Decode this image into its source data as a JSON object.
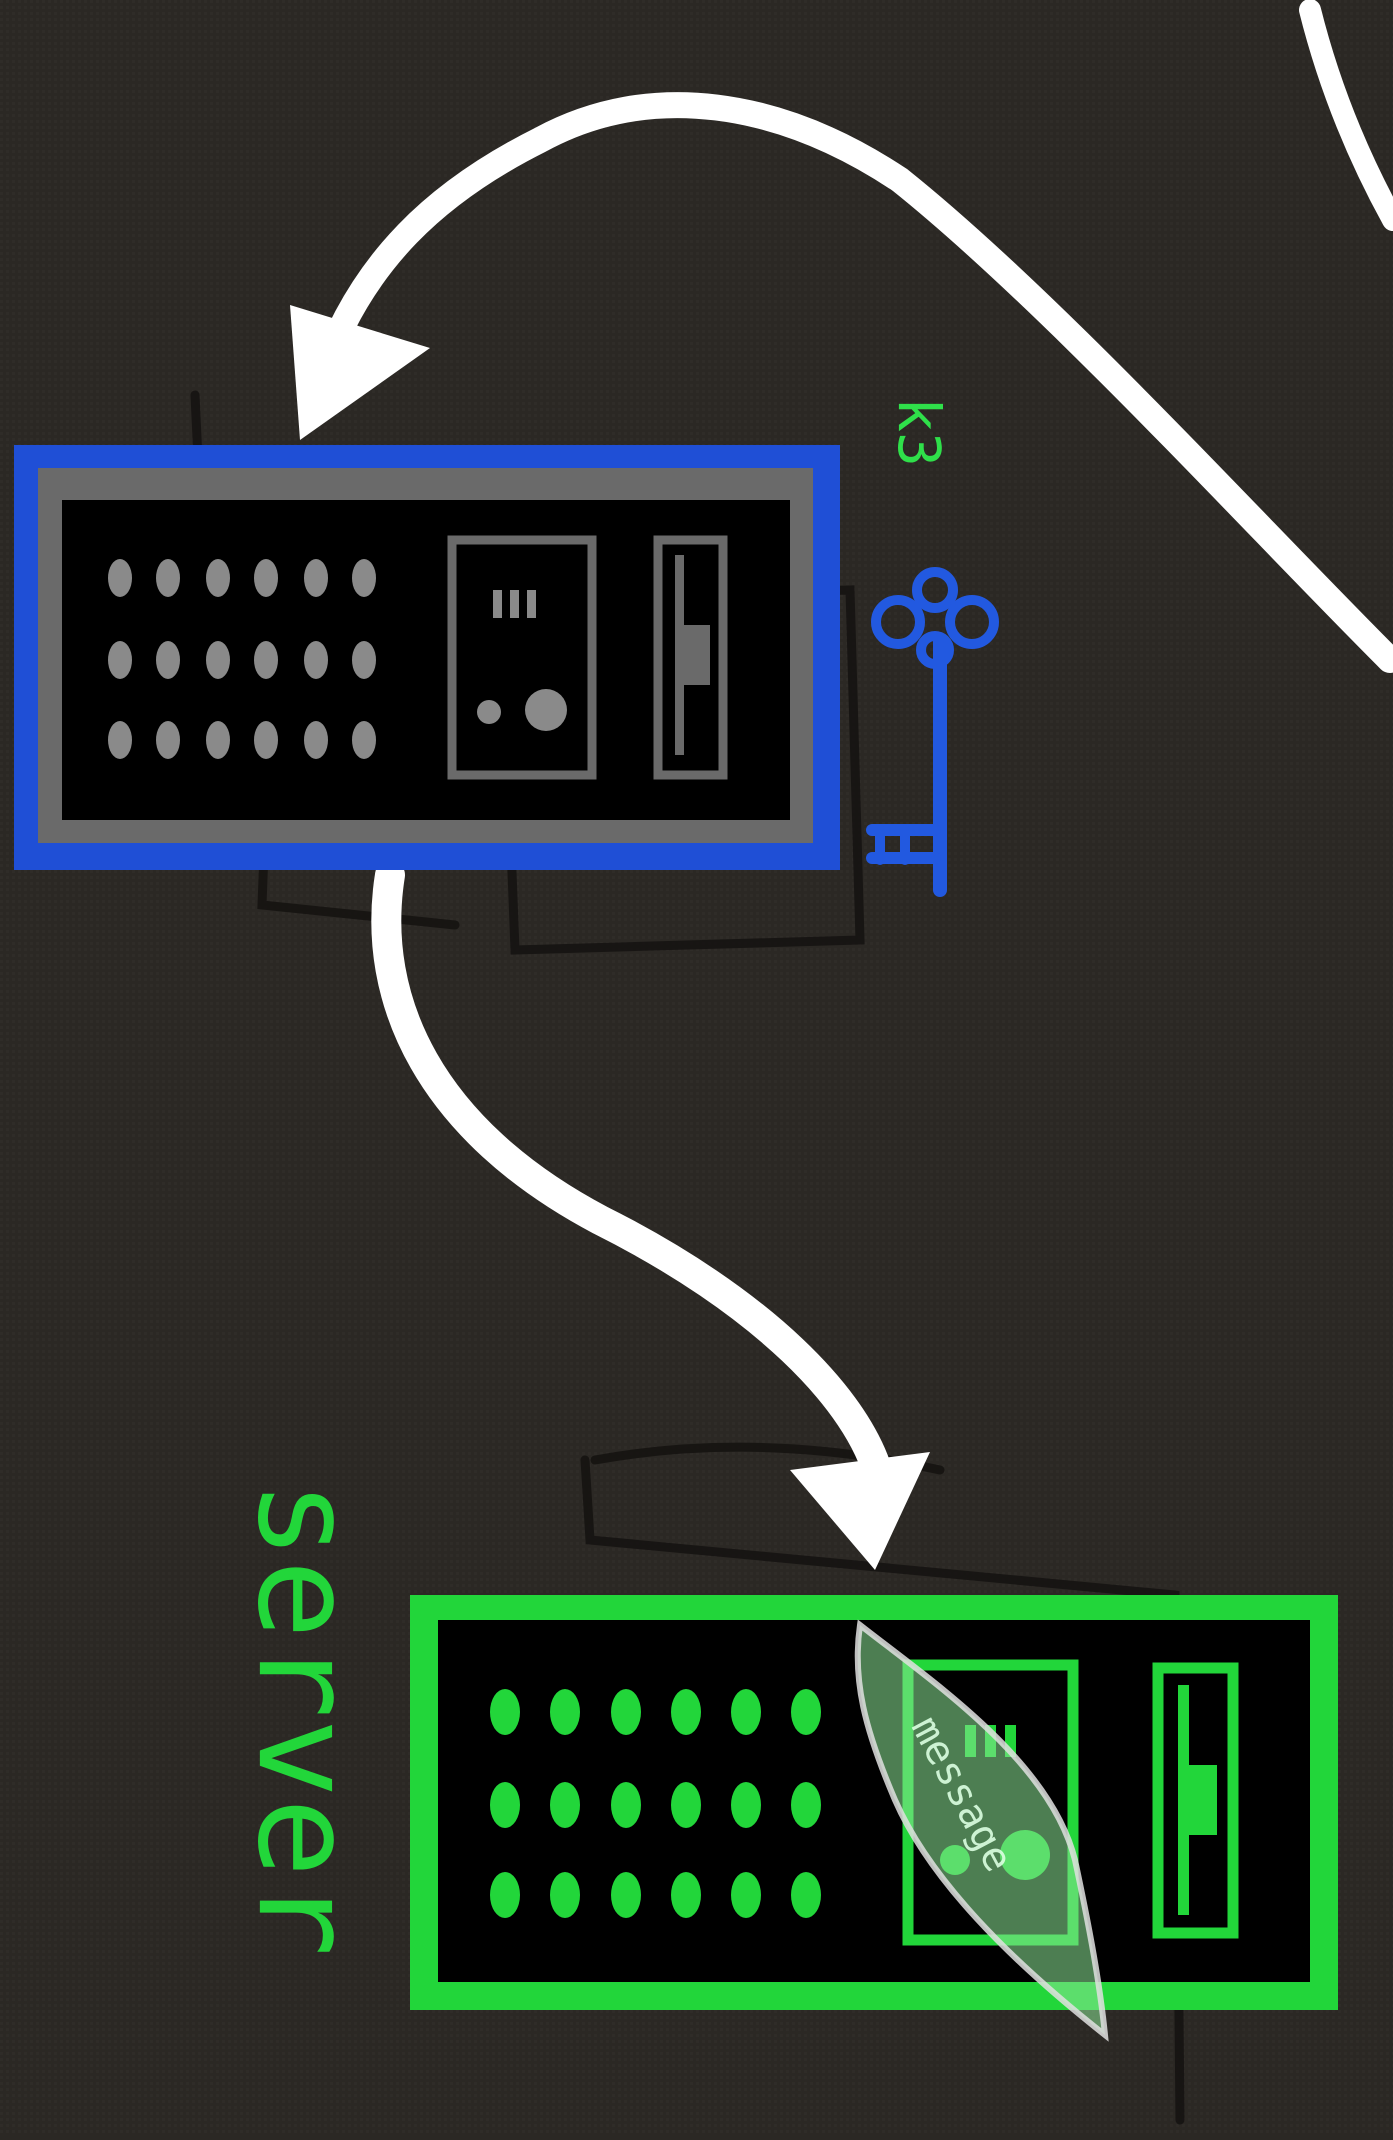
{
  "labels": {
    "server": "server",
    "key": "k3",
    "message": "message"
  },
  "colors": {
    "background": "#2b2824",
    "node_blue": "#1f4fd6",
    "node_green": "#22d63a",
    "bezel_gray": "#6a6a6a",
    "arrow": "#ffffff",
    "key_blue": "#2259e0",
    "key_label_green": "#2fe04a"
  },
  "nodes": [
    {
      "id": "relay-node",
      "accent": "blue"
    },
    {
      "id": "server-node",
      "accent": "green"
    }
  ],
  "edges": [
    {
      "from": "off-canvas",
      "to": "relay-node"
    },
    {
      "from": "relay-node",
      "to": "server-node"
    }
  ],
  "icons": [
    "key-icon",
    "message-leaf-icon"
  ]
}
